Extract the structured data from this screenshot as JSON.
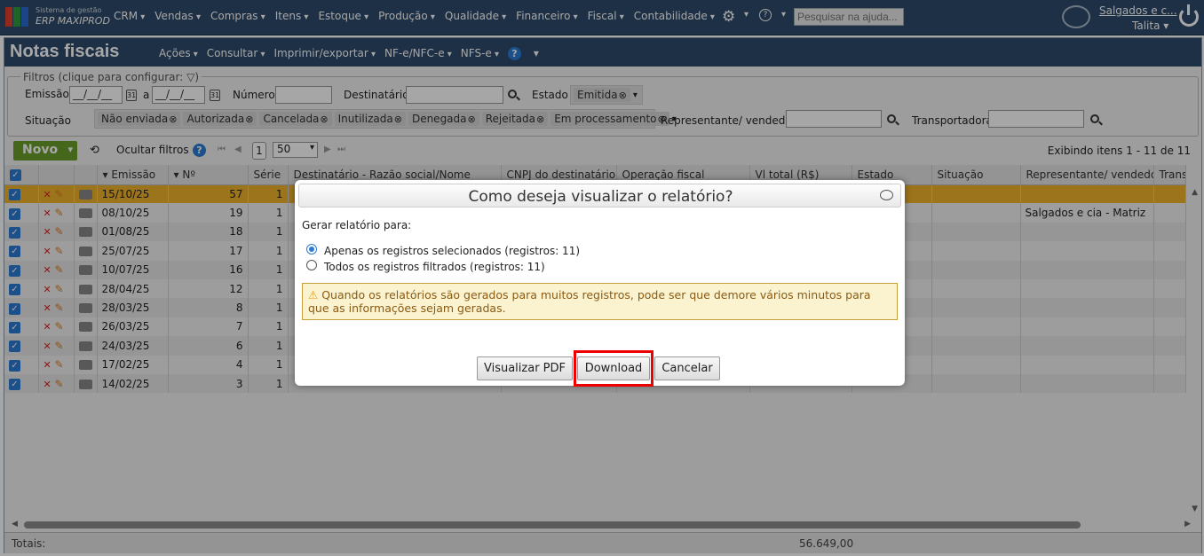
{
  "app": {
    "brand_small": "Sistema de gestão",
    "brand_name": "ERP MAXIPROD"
  },
  "topmenu": [
    "CRM",
    "Vendas",
    "Compras",
    "Itens",
    "Estoque",
    "Produção",
    "Qualidade",
    "Financeiro",
    "Fiscal",
    "Contabilidade"
  ],
  "help_search": {
    "placeholder": "Pesquisar na ajuda..."
  },
  "user": {
    "company": "Salgados e c...",
    "name": "Talita"
  },
  "page": {
    "title": "Notas fiscais",
    "menu": [
      "Ações",
      "Consultar",
      "Imprimir/exportar",
      "NF-e/NFC-e",
      "NFS-e"
    ]
  },
  "filters": {
    "legend": "Filtros (clique para configurar:",
    "emissao_label": "Emissão",
    "date_from": "__/__/__",
    "to_label": "a",
    "date_to": "__/__/__",
    "numero_label": "Número",
    "numero": "",
    "destinatario_label": "Destinatário",
    "destinatario": "",
    "estado_label": "Estado",
    "estado_tags": [
      "Emitida"
    ],
    "situacao_label": "Situação",
    "situacao_tags": [
      "Não enviada",
      "Autorizada",
      "Cancelada",
      "Inutilizada",
      "Denegada",
      "Rejeitada",
      "Em processamento"
    ],
    "representante_label": "Representante/ vendedor",
    "representante": "",
    "transportadora_label": "Transportadora",
    "transportadora": ""
  },
  "toolbar": {
    "new_label": "Novo",
    "hide_filters": "Ocultar filtros",
    "page": "1",
    "page_size": "50",
    "showing": "Exibindo itens 1 - 11 de 11"
  },
  "grid": {
    "columns": [
      "",
      "",
      "",
      "Emissão",
      "Nº",
      "Série",
      "Destinatário - Razão social/Nome",
      "CNPJ do destinatário",
      "Operação fiscal",
      "Vl total (R$)",
      "Estado",
      "Situação",
      "Representante/ vendedor",
      "Trans"
    ],
    "rows": [
      {
        "emissao": "15/10/25",
        "numero": "57",
        "serie": "1",
        "representante": ""
      },
      {
        "emissao": "08/10/25",
        "numero": "19",
        "serie": "1",
        "representante": "Salgados e cia - Matriz"
      },
      {
        "emissao": "01/08/25",
        "numero": "18",
        "serie": "1",
        "representante": ""
      },
      {
        "emissao": "25/07/25",
        "numero": "17",
        "serie": "1",
        "representante": ""
      },
      {
        "emissao": "10/07/25",
        "numero": "16",
        "serie": "1",
        "representante": ""
      },
      {
        "emissao": "28/04/25",
        "numero": "12",
        "serie": "1",
        "representante": ""
      },
      {
        "emissao": "28/03/25",
        "numero": "8",
        "serie": "1",
        "representante": ""
      },
      {
        "emissao": "26/03/25",
        "numero": "7",
        "serie": "1",
        "representante": ""
      },
      {
        "emissao": "24/03/25",
        "numero": "6",
        "serie": "1",
        "representante": ""
      },
      {
        "emissao": "17/02/25",
        "numero": "4",
        "serie": "1",
        "representante": ""
      },
      {
        "emissao": "14/02/25",
        "numero": "3",
        "serie": "1",
        "representante": ""
      }
    ],
    "totals_label": "Totais:",
    "total_value": "56.649,00"
  },
  "dialog": {
    "title": "Como deseja visualizar o relatório?",
    "prompt": "Gerar relatório para:",
    "option_selected": "Apenas os registros selecionados (registros: 11)",
    "option_filtered": "Todos os registros filtrados (registros: 11)",
    "warning": "Quando os relatórios são gerados para muitos registros, pode ser que demore vários minutos para que as informações sejam geradas.",
    "btn_pdf": "Visualizar PDF",
    "btn_download": "Download",
    "btn_cancel": "Cancelar"
  },
  "colors": {
    "header": "#2d4a6b",
    "selected_row": "#f0b32c",
    "new_button": "#6a9e2a",
    "highlight": "#e00000"
  }
}
